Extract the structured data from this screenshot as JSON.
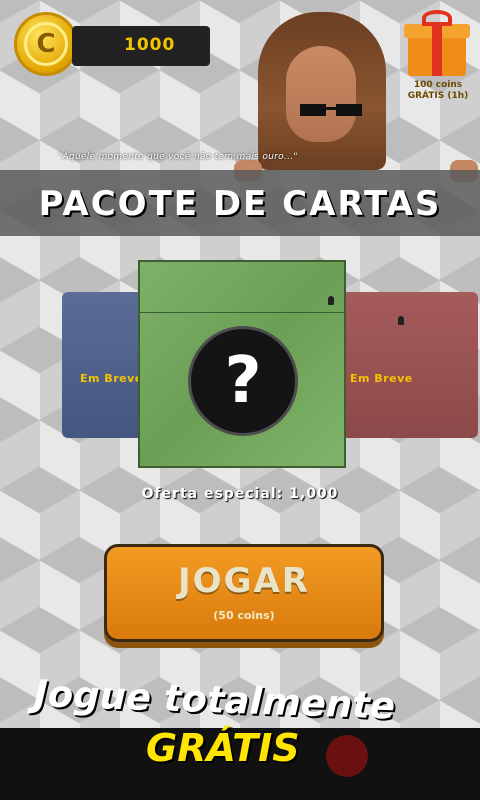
{
  "wallet": {
    "coins": "1000"
  },
  "gift": {
    "label": "100 coins GRÁTIS (1h)"
  },
  "quote": "\"Aquele momento que você não tem mais ouro...\"",
  "title": "PACOTE DE CARTAS",
  "cards": {
    "left_label": "Em Breve",
    "right_label": "Em Breve",
    "center_symbol": "?"
  },
  "offer": "Oferta especial: 1,000",
  "play_button": {
    "label": "JOGAR",
    "sub": "(50 coins)"
  },
  "promo": {
    "line1": "Jogue totalmente",
    "line2": "GRÁTIS"
  },
  "colors": {
    "accent": "#f29b23",
    "promo_yellow": "#ffe600",
    "coin_gold": "#f4c400"
  }
}
